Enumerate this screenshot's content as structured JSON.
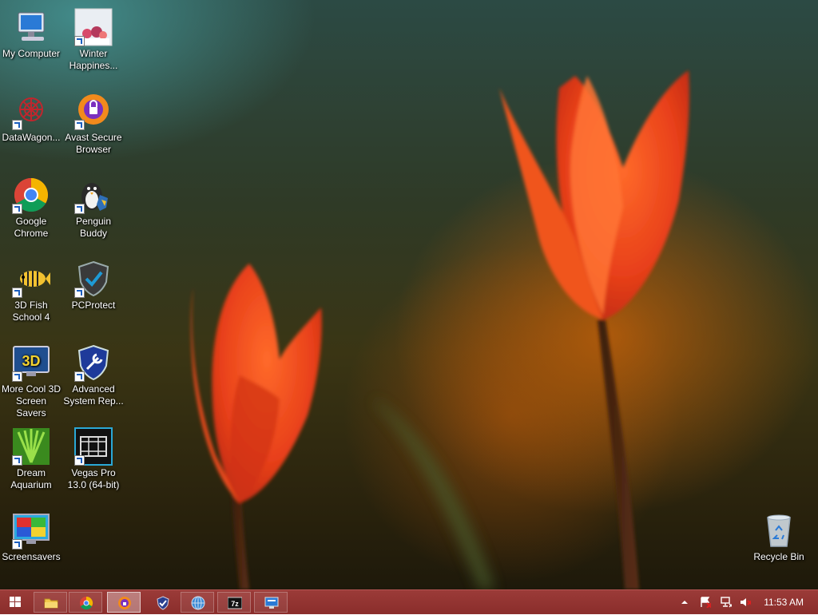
{
  "desktop": {
    "icons": [
      {
        "label": "My Computer",
        "icon": "computer-icon"
      },
      {
        "label": "Winter Happines...",
        "icon": "winter-picture-icon"
      },
      {
        "label": "DataWagon...",
        "icon": "datawagon-icon"
      },
      {
        "label": "Avast Secure Browser",
        "icon": "avast-browser-icon"
      },
      {
        "label": "Google Chrome",
        "icon": "chrome-icon"
      },
      {
        "label": "Penguin Buddy",
        "icon": "penguin-icon"
      },
      {
        "label": "3D Fish School 4",
        "icon": "fish-icon"
      },
      {
        "label": "PCProtect",
        "icon": "shield-check-icon"
      },
      {
        "label": "More Cool 3D Screen Savers",
        "icon": "3d-monitor-icon"
      },
      {
        "label": "Advanced System Rep...",
        "icon": "shield-wrench-icon"
      },
      {
        "label": "Dream Aquarium",
        "icon": "aquarium-icon"
      },
      {
        "label": "Vegas Pro 13.0 (64-bit)",
        "icon": "film-strip-icon"
      },
      {
        "label": "Screensavers",
        "icon": "screensaver-monitor-icon"
      }
    ],
    "recycle_bin": {
      "label": "Recycle Bin",
      "icon": "recycle-bin-icon"
    }
  },
  "taskbar": {
    "start": "windows-logo-icon",
    "pinned": [
      {
        "name": "file-explorer",
        "icon": "folder-icon",
        "active": false
      },
      {
        "name": "chrome",
        "icon": "chrome-icon",
        "active": false
      },
      {
        "name": "avast-browser",
        "icon": "avast-browser-icon",
        "active": true
      },
      {
        "name": "pcprotect",
        "icon": "shield-check-icon",
        "active": false
      },
      {
        "name": "datawagon",
        "icon": "globe-icon",
        "active": false
      },
      {
        "name": "7zip",
        "icon": "7z-icon",
        "active": false
      },
      {
        "name": "screen-settings",
        "icon": "monitor-settings-icon",
        "active": false
      }
    ],
    "tray": {
      "icons": [
        "show-hidden-icons-chevron",
        "action-center-flag-icon",
        "network-icon",
        "volume-muted-icon"
      ],
      "clock": "11:53 AM"
    },
    "colors": {
      "taskbar": "#8f3230",
      "accent": "#b55552"
    }
  }
}
